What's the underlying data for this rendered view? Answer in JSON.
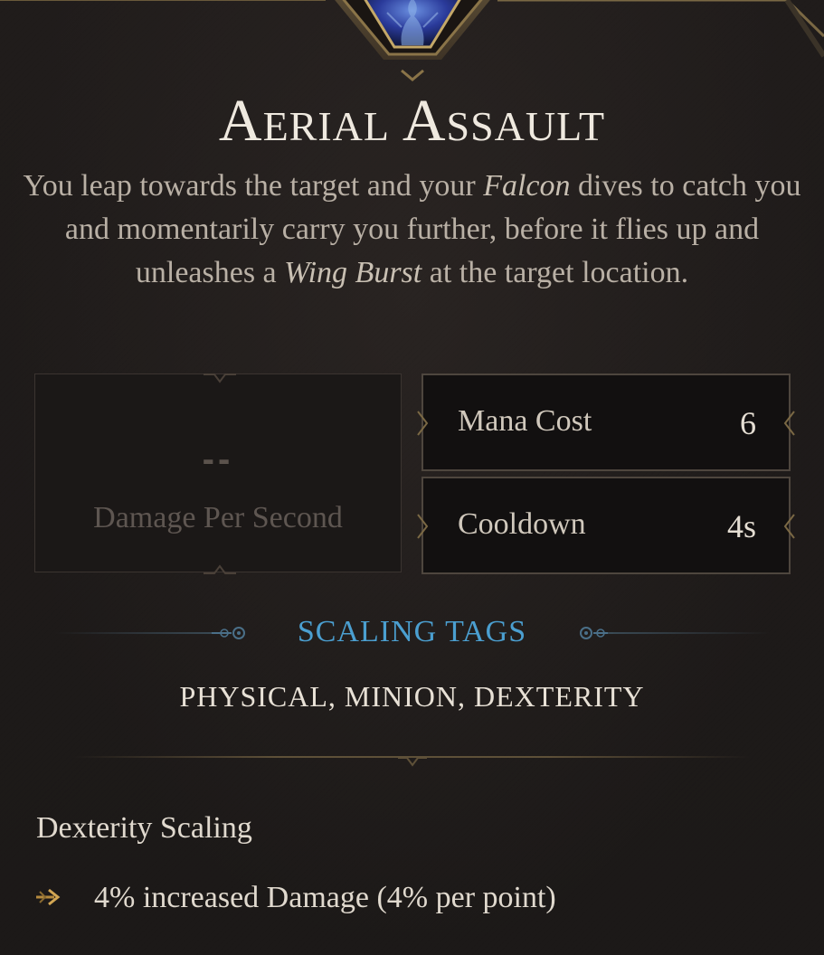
{
  "skill": {
    "name": "Aerial Assault",
    "description": {
      "part1": "You leap towards the target and your ",
      "falcon": "Falcon",
      "part2": " dives to catch you and momentarily carry you further, before it flies up and unleashes a ",
      "wing_burst": "Wing Burst",
      "part3": " at the target location."
    },
    "icon": "falcon-skill-icon"
  },
  "stats": {
    "dps": {
      "value": "--",
      "label": "Damage Per Second"
    },
    "mana_cost": {
      "label": "Mana Cost",
      "value": "6"
    },
    "cooldown": {
      "label": "Cooldown",
      "value": "4s"
    }
  },
  "scaling_tags": {
    "heading": "SCALING TAGS",
    "tags": "PHYSICAL, MINION, DEXTERITY"
  },
  "attribute_scaling": {
    "heading": "Dexterity Scaling",
    "items": [
      "4% increased Damage (4% per point)"
    ],
    "bullet_icon": "arrow-bullet-icon"
  },
  "colors": {
    "accent_blue": "#4b9fd0",
    "gold_trim": "#8a7448",
    "text_light": "#e8e1d6",
    "text_muted": "#b9b0a5",
    "background": "#1e1b1a"
  }
}
